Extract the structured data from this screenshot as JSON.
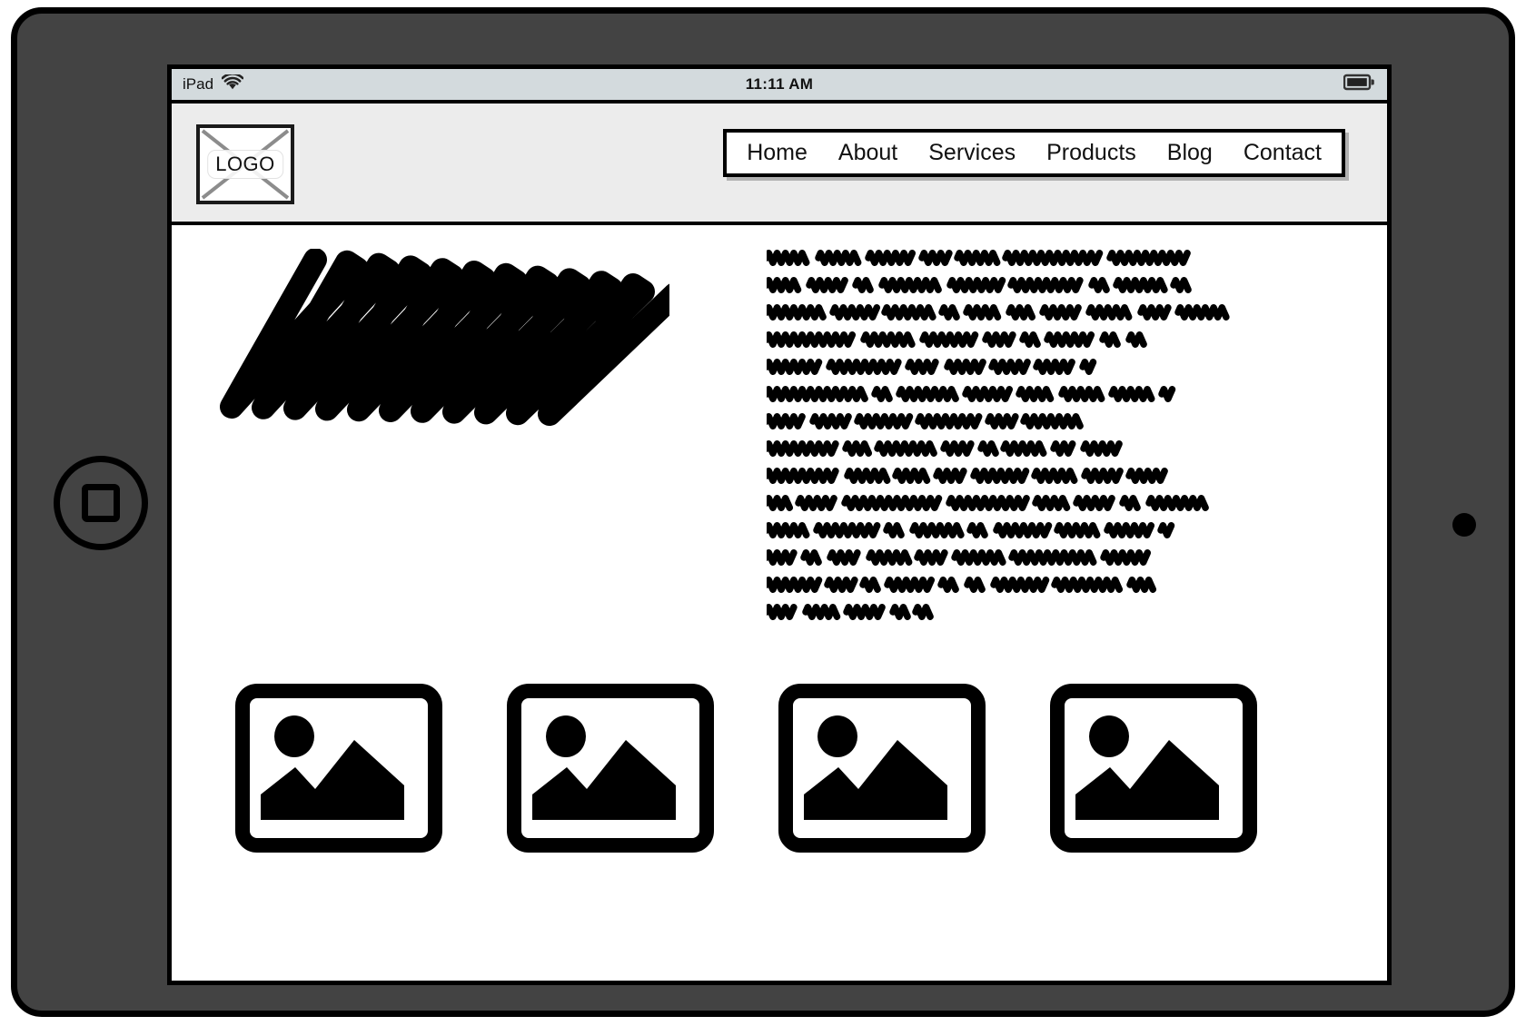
{
  "device": {
    "name": "iPad tablet wireframe mockup",
    "home_button_icon": "home-button-icon",
    "camera_icon": "front-camera-dot",
    "bezel_color": "#434343",
    "frame_border_color": "#000000"
  },
  "status_bar": {
    "carrier": "iPad",
    "wifi_icon": "wifi-icon",
    "time": "11:11 AM",
    "battery_icon": "battery-icon",
    "battery_level_percent": 85,
    "background_color": "#d3dadd"
  },
  "header": {
    "background_color": "#ececec",
    "logo": {
      "label": "LOGO",
      "icon": "image-placeholder-crossed-icon"
    },
    "nav": {
      "items": [
        {
          "label": "Home"
        },
        {
          "label": "About"
        },
        {
          "label": "Services"
        },
        {
          "label": "Products"
        },
        {
          "label": "Blog"
        },
        {
          "label": "Contact"
        }
      ]
    }
  },
  "main": {
    "hero": {
      "icon": "scribble-placeholder",
      "description": "heavy zig-zag scribble block standing in for a hero image"
    },
    "body_text": {
      "icon": "scribbled-text-placeholder",
      "line_count": 14,
      "lines": [
        [
          46,
          44,
          48,
          28,
          42,
          104,
          84
        ],
        [
          36,
          40,
          18,
          64,
          56,
          78,
          16,
          52,
          18
        ],
        [
          62,
          46,
          52,
          16,
          36,
          26,
          40,
          46,
          30,
          54
        ],
        [
          96,
          54,
          58,
          30,
          16,
          50,
          18,
          18
        ],
        [
          58,
          76,
          32,
          38,
          38,
          40,
          12
        ],
        [
          108,
          16,
          62,
          48,
          36,
          44,
          44,
          10
        ],
        [
          40,
          38,
          56,
          66,
          28,
          60
        ],
        [
          76,
          24,
          62,
          30,
          14,
          44,
          22,
          40
        ],
        [
          78,
          42,
          34,
          30,
          56,
          44,
          38,
          40
        ],
        [
          24,
          40,
          104,
          84,
          34,
          40,
          18,
          60
        ],
        [
          44,
          66,
          18,
          52,
          18,
          56,
          44,
          48,
          12
        ],
        [
          30,
          18,
          32,
          42,
          30,
          52,
          90,
          50
        ],
        [
          56,
          28,
          16,
          48,
          18,
          18,
          56,
          72,
          26
        ],
        [
          32,
          34,
          40,
          14,
          16
        ]
      ]
    },
    "thumbnails": [
      {
        "icon": "image-placeholder-icon",
        "name": "thumbnail-1"
      },
      {
        "icon": "image-placeholder-icon",
        "name": "thumbnail-2"
      },
      {
        "icon": "image-placeholder-icon",
        "name": "thumbnail-3"
      },
      {
        "icon": "image-placeholder-icon",
        "name": "thumbnail-4"
      }
    ]
  }
}
